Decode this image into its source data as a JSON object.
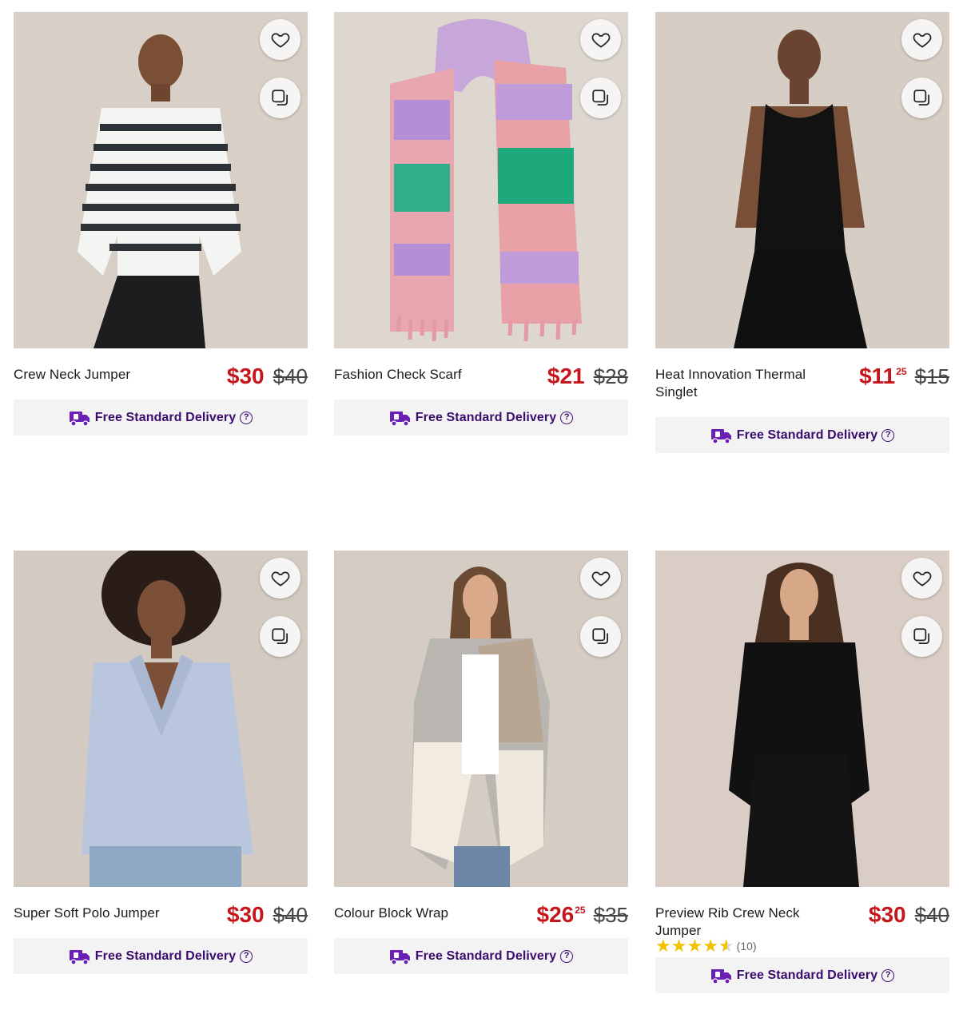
{
  "icons": {
    "favourite": "heart-outline-icon",
    "compare": "compare-squares-icon",
    "delivery": "delivery-truck-icon",
    "help": "help-circle-icon"
  },
  "colors": {
    "sale_price": "#c4161c",
    "delivery_text": "#3a0d6e",
    "delivery_icon": "#6a1fb5",
    "star": "#f2c200"
  },
  "products": [
    {
      "name": "Crew Neck Jumper",
      "price_now": "$30",
      "price_cents": "",
      "price_was": "$40",
      "delivery": "Free Standard Delivery"
    },
    {
      "name": "Fashion Check Scarf",
      "price_now": "$21",
      "price_cents": "",
      "price_was": "$28",
      "delivery": "Free Standard Delivery"
    },
    {
      "name": "Heat Innovation Thermal Singlet",
      "price_now": "$11",
      "price_cents": "25",
      "price_was": "$15",
      "delivery": "Free Standard Delivery"
    },
    {
      "name": "Super Soft Polo Jumper",
      "price_now": "$30",
      "price_cents": "",
      "price_was": "$40",
      "delivery": "Free Standard Delivery"
    },
    {
      "name": "Colour Block Wrap",
      "price_now": "$26",
      "price_cents": "25",
      "price_was": "$35",
      "delivery": "Free Standard Delivery"
    },
    {
      "name": "Preview Rib Crew Neck Jumper",
      "price_now": "$30",
      "price_cents": "",
      "price_was": "$40",
      "rating": 4.5,
      "rating_count": "(10)",
      "delivery": "Free Standard Delivery"
    }
  ]
}
